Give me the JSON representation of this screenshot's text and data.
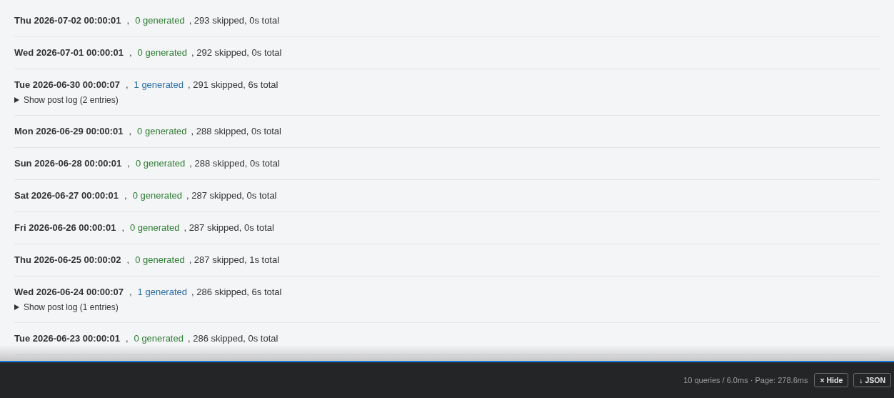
{
  "runs": [
    {
      "date": "Thu 2026-07-02 00:00:01",
      "separator": ",",
      "generated": "0 generated",
      "color": "#2e7d32",
      "rest": ", 293 skipped, 0s total"
    },
    {
      "date": "Wed 2026-07-01 00:00:01",
      "separator": ",",
      "generated": "0 generated",
      "color": "#2e7d32",
      "rest": ", 292 skipped, 0s total"
    },
    {
      "date": "Tue 2026-06-30 00:00:07",
      "separator": ",",
      "generated": "1 generated",
      "color": "#2a6db0",
      "rest": ", 291 skipped, 6s total",
      "post_log": {
        "label": "Show post log (2 entries)",
        "expanded": false
      }
    },
    {
      "date": "Mon 2026-06-29 00:00:01",
      "separator": ",",
      "generated": "0 generated",
      "color": "#2e7d32",
      "rest": ", 288 skipped, 0s total"
    },
    {
      "date": "Sun 2026-06-28 00:00:01",
      "separator": ",",
      "generated": "0 generated",
      "color": "#2e7d32",
      "rest": ", 288 skipped, 0s total"
    },
    {
      "date": "Sat 2026-06-27 00:00:01",
      "separator": ",",
      "generated": "0 generated",
      "color": "#2e7d32",
      "rest": ", 287 skipped, 0s total"
    },
    {
      "date": "Fri 2026-06-26 00:00:01",
      "separator": ",",
      "generated": "0 generated",
      "color": "#2e7d32",
      "rest": ", 287 skipped, 0s total"
    },
    {
      "date": "Thu 2026-06-25 00:00:02",
      "separator": ",",
      "generated": "0 generated",
      "color": "#2e7d32",
      "rest": ", 287 skipped, 1s total"
    },
    {
      "date": "Wed 2026-06-24 00:00:07",
      "separator": ",",
      "generated": "1 generated",
      "color": "#2a6db0",
      "rest": ", 286 skipped, 6s total",
      "post_log": {
        "label": "Show post log (1 entries)",
        "expanded": false
      }
    },
    {
      "date": "Tue 2026-06-23 00:00:01",
      "separator": ",",
      "generated": "0 generated",
      "color": "#2e7d32",
      "rest": ", 286 skipped, 0s total"
    }
  ],
  "debug_bar": {
    "stats": "10 queries / 6.0ms · Page: 278.6ms",
    "buttons": [
      "× Hide",
      "↓ JSON"
    ]
  }
}
